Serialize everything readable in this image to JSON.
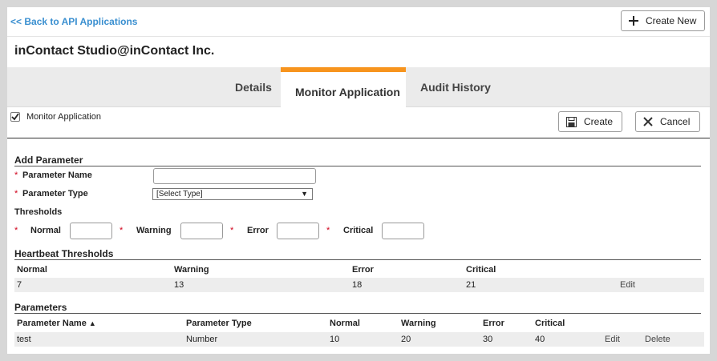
{
  "header": {
    "back_link": "<< Back to API Applications",
    "create_new": "Create New",
    "app_title": "inContact Studio@inContact Inc."
  },
  "tabs": [
    "Details",
    "Monitor Application",
    "Audit History"
  ],
  "monitor": {
    "checkbox_label": "Monitor Application",
    "checked": true,
    "create_button": "Create",
    "cancel_button": "Cancel"
  },
  "add_parameter": {
    "title": "Add Parameter",
    "required_mark": "*",
    "name_label": "Parameter Name",
    "name_value": "",
    "type_label": "Parameter Type",
    "type_selected": "[Select Type]",
    "thresholds_title": "Thresholds",
    "thresholds": [
      "Normal",
      "Warning",
      "Error",
      "Critical"
    ]
  },
  "heartbeat": {
    "title": "Heartbeat Thresholds",
    "columns": [
      "Normal",
      "Warning",
      "Error",
      "Critical"
    ],
    "row": [
      "7",
      "13",
      "18",
      "21"
    ],
    "edit": "Edit"
  },
  "parameters": {
    "title": "Parameters",
    "columns": [
      "Parameter Name",
      "Parameter Type",
      "Normal",
      "Warning",
      "Error",
      "Critical"
    ],
    "rows": [
      [
        "test",
        "Number",
        "10",
        "20",
        "30",
        "40"
      ]
    ],
    "edit": "Edit",
    "delete": "Delete"
  }
}
